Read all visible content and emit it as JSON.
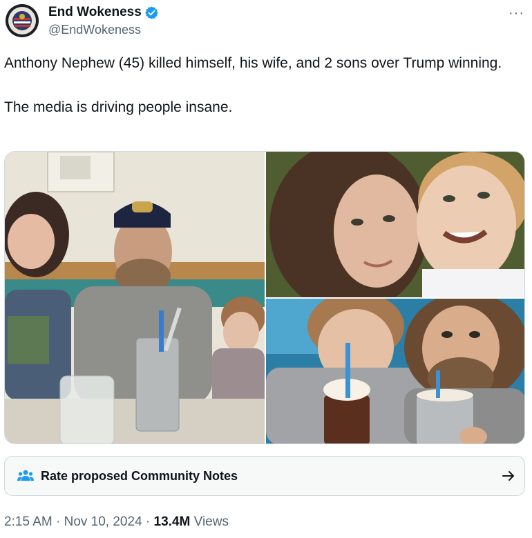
{
  "author": {
    "display_name": "End Wokeness",
    "handle": "@EndWokeness",
    "verified": true,
    "verified_color": "#1d9bf0"
  },
  "tweet": {
    "text_line_1": "Anthony Nephew (45) killed himself, his wife, and 2 sons over Trump winning.",
    "text_line_2": "The media is driving people insane."
  },
  "media": {
    "photos": [
      {
        "name": "diner-booth-family-photo"
      },
      {
        "name": "mother-and-son-selfie"
      },
      {
        "name": "father-and-son-milkshakes"
      }
    ]
  },
  "community_notes": {
    "label": "Rate proposed Community Notes",
    "icon": "people-icon",
    "accent": "#1d9bf0"
  },
  "meta": {
    "time": "2:15 AM",
    "sep1": " · ",
    "date": "Nov 10, 2024",
    "sep2": " · ",
    "views_count": "13.4M",
    "views_label": " Views"
  },
  "icons": {
    "more": "more-icon",
    "arrow": "arrow-right-icon"
  }
}
